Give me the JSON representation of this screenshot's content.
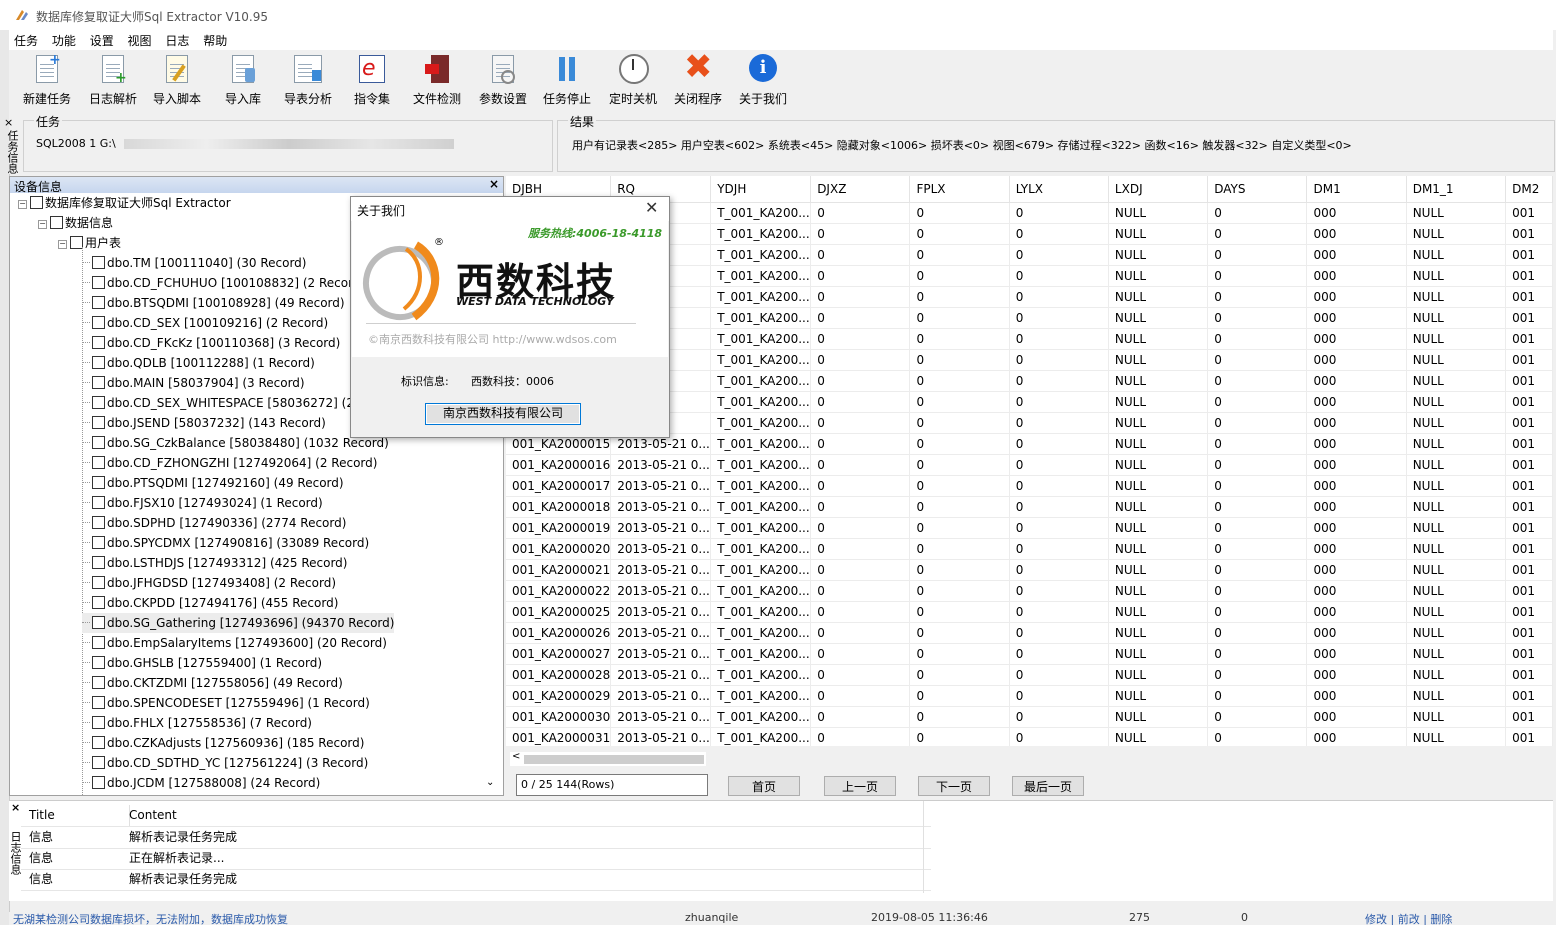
{
  "window": {
    "title": "数据库修复取证大师Sql Extractor V10.95"
  },
  "menu": [
    "任务",
    "功能",
    "设置",
    "视图",
    "日志",
    "帮助"
  ],
  "toolbar": [
    {
      "label": "新建任务",
      "icon": "new-task-icon"
    },
    {
      "label": "日志解析",
      "icon": "log-parse-icon"
    },
    {
      "label": "导入脚本",
      "icon": "import-script-icon"
    },
    {
      "label": "导入库",
      "icon": "import-db-icon"
    },
    {
      "label": "导表分析",
      "icon": "table-analysis-icon"
    },
    {
      "label": "指令集",
      "icon": "command-set-icon"
    },
    {
      "label": "文件检测",
      "icon": "file-check-icon"
    },
    {
      "label": "参数设置",
      "icon": "settings-icon"
    },
    {
      "label": "任务停止",
      "icon": "pause-icon"
    },
    {
      "label": "定时关机",
      "icon": "clock-icon"
    },
    {
      "label": "关闭程序",
      "icon": "close-program-icon"
    },
    {
      "label": "关于我们",
      "icon": "info-icon"
    }
  ],
  "task_panel": {
    "vertical_tab": "任务信息",
    "task_caption": "任务",
    "task_value": "SQL2008 1 G:\\",
    "result_caption": "结果",
    "result_value": "用户有记录表<285> 用户空表<602> 系统表<45> 隐藏对象<1006> 损坏表<0> 视图<679> 存储过程<322> 函数<16> 触发器<32> 自定义类型<0>"
  },
  "tree": {
    "header": "设备信息",
    "root": "数据库修复取证大师Sql Extractor",
    "db": "数据信息",
    "group": "用户表",
    "items": [
      "dbo.TM [100111040] (30 Record)",
      "dbo.CD_FCHUHUO [100108832] (2 Record)",
      "dbo.BTSQDMI [100108928] (49 Record)",
      "dbo.CD_SEX [100109216] (2 Record)",
      "dbo.CD_FKcKz [100110368] (3 Record)",
      "dbo.QDLB [100112288] (1 Record)",
      "dbo.MAIN [58037904] (3 Record)",
      "dbo.CD_SEX_WHITESPACE [58036272] (2 R",
      "dbo.JSEND [58037232] (143 Record)",
      "dbo.SG_CzkBalance [58038480] (1032 Record)",
      "dbo.CD_FZHONGZHI [127492064] (2 Record)",
      "dbo.PTSQDMI [127492160] (49 Record)",
      "dbo.FJSX10 [127493024] (1 Record)",
      "dbo.SDPHD [127490336] (2774 Record)",
      "dbo.SPYCDMX [127490816] (33089 Record)",
      "dbo.LSTHDJS [127493312] (425 Record)",
      "dbo.JFHGDSD [127493408] (2 Record)",
      "dbo.CKPDD [127494176] (455 Record)",
      "dbo.SG_Gathering [127493696] (94370 Record)",
      "dbo.EmpSalaryItems [127493600] (20 Record)",
      "dbo.GHSLB [127559400] (1 Record)",
      "dbo.CKTZDMI [127558056] (49 Record)",
      "dbo.SPENCODESET [127559496] (1 Record)",
      "dbo.FHLX [127558536] (7 Record)",
      "dbo.CZKAdjusts [127560936] (185 Record)",
      "dbo.CD_SDTHD_YC [127561224] (3 Record)",
      "dbo.JCDM [127588008] (24 Record)"
    ]
  },
  "grid": {
    "columns": [
      "DJBH",
      "RQ",
      "YDJH",
      "DJXZ",
      "FPLX",
      "LYLX",
      "LXDJ",
      "DAYS",
      "DM1",
      "DM1_1",
      "DM2"
    ],
    "rows": [
      [
        "",
        "21 0...",
        "T_001_KA200...",
        "0",
        "0",
        "0",
        "NULL",
        "0",
        "000",
        "NULL",
        "001"
      ],
      [
        "",
        "21 0...",
        "T_001_KA200...",
        "0",
        "0",
        "0",
        "NULL",
        "0",
        "000",
        "NULL",
        "001"
      ],
      [
        "",
        "21 0...",
        "T_001_KA200...",
        "0",
        "0",
        "0",
        "NULL",
        "0",
        "000",
        "NULL",
        "001"
      ],
      [
        "",
        "21 0...",
        "T_001_KA200...",
        "0",
        "0",
        "0",
        "NULL",
        "0",
        "000",
        "NULL",
        "001"
      ],
      [
        "",
        "21 0...",
        "T_001_KA200...",
        "0",
        "0",
        "0",
        "NULL",
        "0",
        "000",
        "NULL",
        "001"
      ],
      [
        "",
        "21 0...",
        "T_001_KA200...",
        "0",
        "0",
        "0",
        "NULL",
        "0",
        "000",
        "NULL",
        "001"
      ],
      [
        "",
        "21 0...",
        "T_001_KA200...",
        "0",
        "0",
        "0",
        "NULL",
        "0",
        "000",
        "NULL",
        "001"
      ],
      [
        "",
        "21 0...",
        "T_001_KA200...",
        "0",
        "0",
        "0",
        "NULL",
        "0",
        "000",
        "NULL",
        "001"
      ],
      [
        "",
        "21 0...",
        "T_001_KA200...",
        "0",
        "0",
        "0",
        "NULL",
        "0",
        "000",
        "NULL",
        "001"
      ],
      [
        "",
        "21 0...",
        "T_001_KA200...",
        "0",
        "0",
        "0",
        "NULL",
        "0",
        "000",
        "NULL",
        "001"
      ],
      [
        "",
        "21 0...",
        "T_001_KA200...",
        "0",
        "0",
        "0",
        "NULL",
        "0",
        "000",
        "NULL",
        "001"
      ],
      [
        "001_KA2000015",
        "2013-05-21 0...",
        "T_001_KA200...",
        "0",
        "0",
        "0",
        "NULL",
        "0",
        "000",
        "NULL",
        "001"
      ],
      [
        "001_KA2000016",
        "2013-05-21 0...",
        "T_001_KA200...",
        "0",
        "0",
        "0",
        "NULL",
        "0",
        "000",
        "NULL",
        "001"
      ],
      [
        "001_KA2000017",
        "2013-05-21 0...",
        "T_001_KA200...",
        "0",
        "0",
        "0",
        "NULL",
        "0",
        "000",
        "NULL",
        "001"
      ],
      [
        "001_KA2000018",
        "2013-05-21 0...",
        "T_001_KA200...",
        "0",
        "0",
        "0",
        "NULL",
        "0",
        "000",
        "NULL",
        "001"
      ],
      [
        "001_KA2000019",
        "2013-05-21 0...",
        "T_001_KA200...",
        "0",
        "0",
        "0",
        "NULL",
        "0",
        "000",
        "NULL",
        "001"
      ],
      [
        "001_KA2000020",
        "2013-05-21 0...",
        "T_001_KA200...",
        "0",
        "0",
        "0",
        "NULL",
        "0",
        "000",
        "NULL",
        "001"
      ],
      [
        "001_KA2000021",
        "2013-05-21 0...",
        "T_001_KA200...",
        "0",
        "0",
        "0",
        "NULL",
        "0",
        "000",
        "NULL",
        "001"
      ],
      [
        "001_KA2000022",
        "2013-05-21 0...",
        "T_001_KA200...",
        "0",
        "0",
        "0",
        "NULL",
        "0",
        "000",
        "NULL",
        "001"
      ],
      [
        "001_KA2000025",
        "2013-05-21 0...",
        "T_001_KA200...",
        "0",
        "0",
        "0",
        "NULL",
        "0",
        "000",
        "NULL",
        "001"
      ],
      [
        "001_KA2000026",
        "2013-05-21 0...",
        "T_001_KA200...",
        "0",
        "0",
        "0",
        "NULL",
        "0",
        "000",
        "NULL",
        "001"
      ],
      [
        "001_KA2000027",
        "2013-05-21 0...",
        "T_001_KA200...",
        "0",
        "0",
        "0",
        "NULL",
        "0",
        "000",
        "NULL",
        "001"
      ],
      [
        "001_KA2000028",
        "2013-05-21 0...",
        "T_001_KA200...",
        "0",
        "0",
        "0",
        "NULL",
        "0",
        "000",
        "NULL",
        "001"
      ],
      [
        "001_KA2000029",
        "2013-05-21 0...",
        "T_001_KA200...",
        "0",
        "0",
        "0",
        "NULL",
        "0",
        "000",
        "NULL",
        "001"
      ],
      [
        "001_KA2000030",
        "2013-05-21 0...",
        "T_001_KA200...",
        "0",
        "0",
        "0",
        "NULL",
        "0",
        "000",
        "NULL",
        "001"
      ],
      [
        "001_KA2000031",
        "2013-05-21 0...",
        "T_001_KA200...",
        "0",
        "0",
        "0",
        "NULL",
        "0",
        "000",
        "NULL",
        "001"
      ]
    ]
  },
  "pager": {
    "info": "0 / 25  144(Rows)",
    "first": "首页",
    "prev": "上一页",
    "next": "下一页",
    "last": "最后一页"
  },
  "log": {
    "vertical_tab": "日志信息",
    "col_title": "Title",
    "col_content": "Content",
    "rows": [
      {
        "title": "信息",
        "content": "解析表记录任务完成"
      },
      {
        "title": "信息",
        "content": "正在解析表记录..."
      },
      {
        "title": "信息",
        "content": "解析表记录任务完成"
      }
    ]
  },
  "status": {
    "text": "无湖某检测公司数据库损坏，无法附加，数据库成功恢复",
    "user": "zhuanqile",
    "date": "2019-08-05 11:36:46",
    "n1": "275",
    "n2": "0",
    "actions": "修改 | 前改 | 删除"
  },
  "about_dialog": {
    "title": "关于我们",
    "hotline": "服务热线:4006-18-4118",
    "brand_cn": "西数科技",
    "brand_en": "WEST DATA TECHNOLOGY",
    "copyright": "©南京西数科技有限公司  http://www.wdsos.com",
    "id_label": "标识信息:",
    "id_value": "西数科技：0006",
    "button": "南京西数科技有限公司"
  },
  "colors": {
    "accent_orange": "#f08a1c",
    "hotline_green": "#3a9a2a",
    "tree_header": "#c6d6ee"
  }
}
